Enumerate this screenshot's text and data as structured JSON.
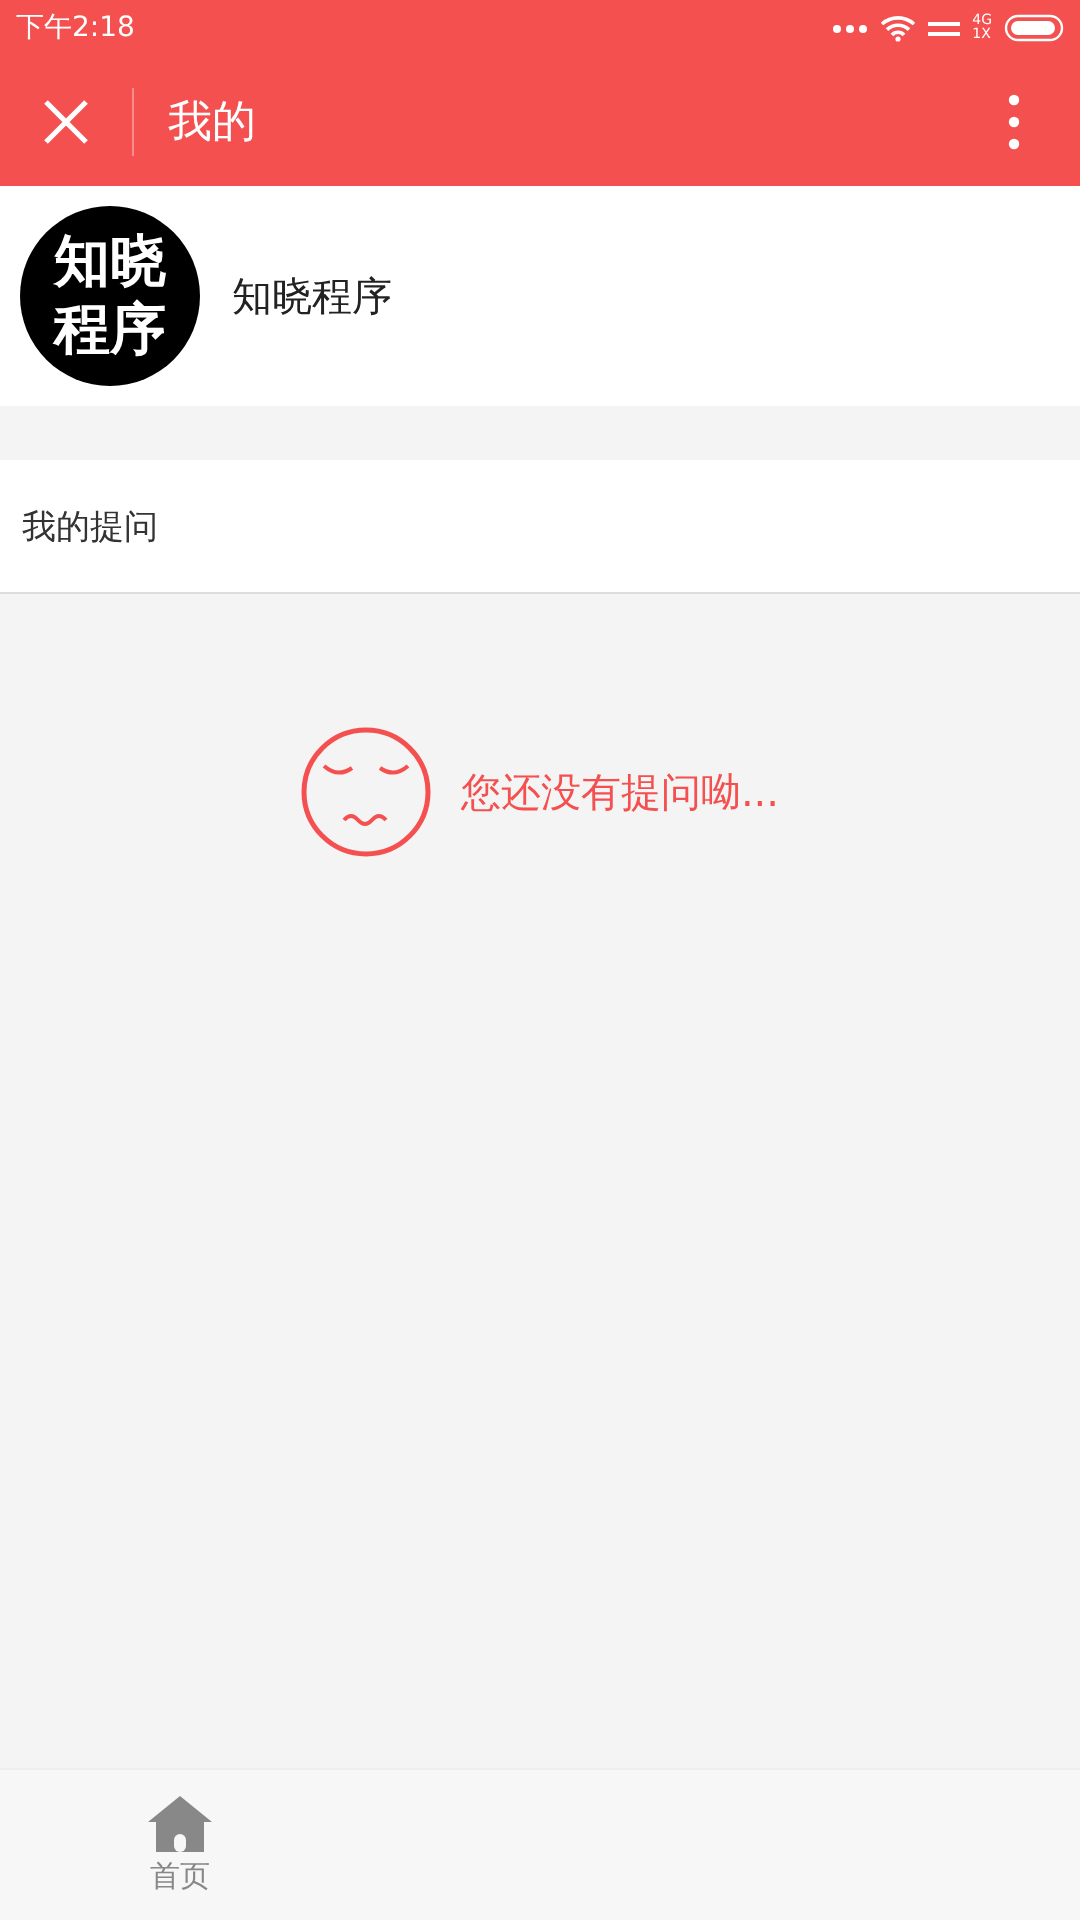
{
  "status_bar": {
    "time": "下午2:18",
    "network": "4G\n1X"
  },
  "header": {
    "title": "我的"
  },
  "profile": {
    "avatar_lines": [
      "知晓",
      "程序"
    ],
    "name": "知晓程序"
  },
  "section": {
    "title": "我的提问"
  },
  "empty_state": {
    "message": "您还没有提问呦..."
  },
  "tab_bar": {
    "items": [
      {
        "label": "首页",
        "selected": false
      }
    ]
  }
}
